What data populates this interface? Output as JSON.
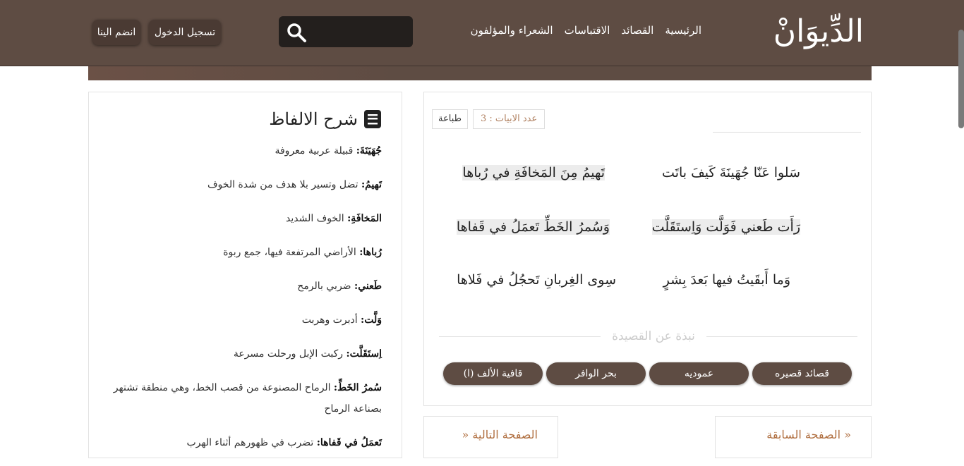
{
  "header": {
    "logo_text": "الدِّيوَانْ",
    "nav": [
      "الرئيسية",
      "القصائد",
      "الاقتباسات",
      "الشعراء والمؤلفون"
    ],
    "search": {
      "placeholder": "",
      "icon": "search-icon"
    },
    "login_label": "تسجيل الدخول",
    "join_label": "انضم الينا"
  },
  "poem": {
    "print_label": "طباعة",
    "verse_count_label": "عدد الابيات : 3",
    "verses": [
      {
        "right": "سَلوا عَنّا جُهَينَةَ كَيفَ باتَت",
        "left": "تَهيمُ مِنَ المَخافَةِ في رُباها"
      },
      {
        "right": "رَأَت طَعني فَوَلَّت وَاِستَقَلَّت",
        "left": "وَسُمرُ الخَطِّ تَعمَلُ في قَفاها"
      },
      {
        "right": "وَما أَبقَيتُ فيها بَعدَ بِشرٍ",
        "left": "سِوى الغِربانِ تَحجُلُ في فَلاها"
      }
    ],
    "about_label": "نبذة عن القصيدة",
    "tags": [
      "قصائد قصيره",
      "عموديه",
      "بحر الوافر",
      "قافية الألف (ا)"
    ]
  },
  "glossary": {
    "title": "شرح الالفاظ",
    "items": [
      {
        "term": "جُهَيَنَةَ:",
        "def": " قبيلة عربية معروفة"
      },
      {
        "term": "تَهيمُ:",
        "def": " تضل وتسير بلا هدف من شدة الخوف"
      },
      {
        "term": "المَخافَةِ:",
        "def": " الخوف الشديد"
      },
      {
        "term": "رُباها:",
        "def": " الأراضي المرتفعة فيها، جمع ربوة"
      },
      {
        "term": "طَعني:",
        "def": " ضربي بالرمح"
      },
      {
        "term": "وَلَّت:",
        "def": " أدبرت وهربت"
      },
      {
        "term": "اِستَقَلَّت:",
        "def": " ركبت الإبل ورحلت مسرعة"
      },
      {
        "term": "سُمرُ الخَطِّ:",
        "def": " الرماح المصنوعة من قصب الخط، وهي منطقة تشتهر بصناعة الرماح"
      },
      {
        "term": "تَعمَلُ في قَفاها:",
        "def": " تضرب في ظهورهم أثناء الهرب"
      }
    ]
  },
  "pagination": {
    "prev_label": "« الصفحة السابقة",
    "next_label": "الصفحة التالية «"
  }
}
